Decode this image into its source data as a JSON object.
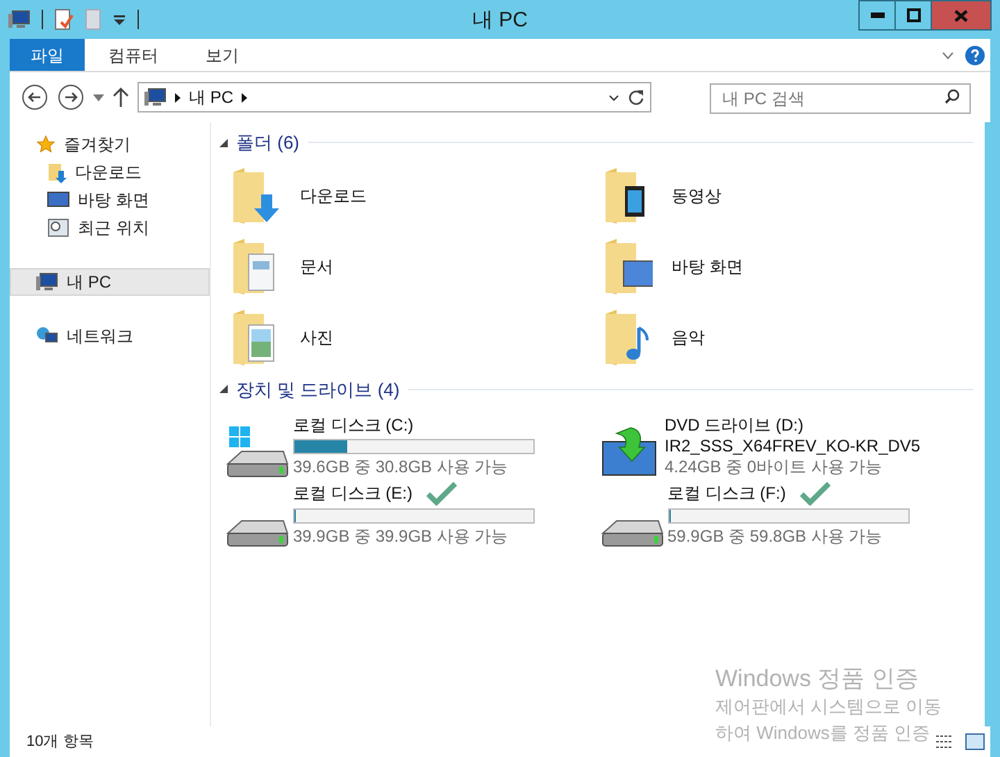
{
  "window": {
    "title": "내 PC"
  },
  "ribbon_tabs": [
    {
      "label": "파일",
      "selected": true
    },
    {
      "label": "컴퓨터",
      "selected": false
    },
    {
      "label": "보기",
      "selected": false
    }
  ],
  "address": {
    "path": "내 PC"
  },
  "search": {
    "placeholder": "내 PC 검색"
  },
  "sidebar": {
    "items": [
      {
        "label": "즐겨찾기",
        "kind": "favorites",
        "selected": false,
        "children": [
          {
            "label": "다운로드",
            "kind": "downloads",
            "selected": false
          },
          {
            "label": "바탕 화면",
            "kind": "desktop",
            "selected": false
          },
          {
            "label": "최근 위치",
            "kind": "recent",
            "selected": false
          }
        ]
      },
      {
        "label": "내 PC",
        "kind": "pc",
        "selected": true
      },
      {
        "label": "네트워크",
        "kind": "network",
        "selected": false
      }
    ]
  },
  "folders": {
    "heading": "폴더 (6)",
    "items": [
      {
        "name": "다운로드",
        "kind": "download"
      },
      {
        "name": "동영상",
        "kind": "video"
      },
      {
        "name": "문서",
        "kind": "documents"
      },
      {
        "name": "바탕 화면",
        "kind": "desktop"
      },
      {
        "name": "사진",
        "kind": "pictures"
      },
      {
        "name": "음악",
        "kind": "music"
      }
    ]
  },
  "drives": {
    "heading": "장치 및 드라이브 (4)",
    "items": [
      {
        "name": "로컬 디스크 (C:)",
        "kind": "system",
        "level": 0.22,
        "space": "39.6GB 중 30.8GB 사용 가능",
        "checkmark": false
      },
      {
        "name": "DVD 드라이브 (D:)",
        "kind": "dvd",
        "label": "IR2_SSS_X64FREV_KO-KR_DV5",
        "space": "4.24GB 중 0바이트 사용 가능",
        "checkmark": false
      },
      {
        "name": "로컬 디스크 (E:)",
        "kind": "disk",
        "level": 0,
        "space": "39.9GB 중 39.9GB 사용 가능",
        "checkmark": true
      },
      {
        "name": "로컬 디스크 (F:)",
        "kind": "disk",
        "level": 0.002,
        "space": "59.9GB 중 59.8GB 사용 가능",
        "checkmark": true
      }
    ]
  },
  "status_bar": {
    "count": "10개 항목"
  },
  "activation_notice": [
    "Windows 정품 인증",
    "제어판에서 시스템으로 이동",
    "하여 Windows를 정품 인증"
  ]
}
